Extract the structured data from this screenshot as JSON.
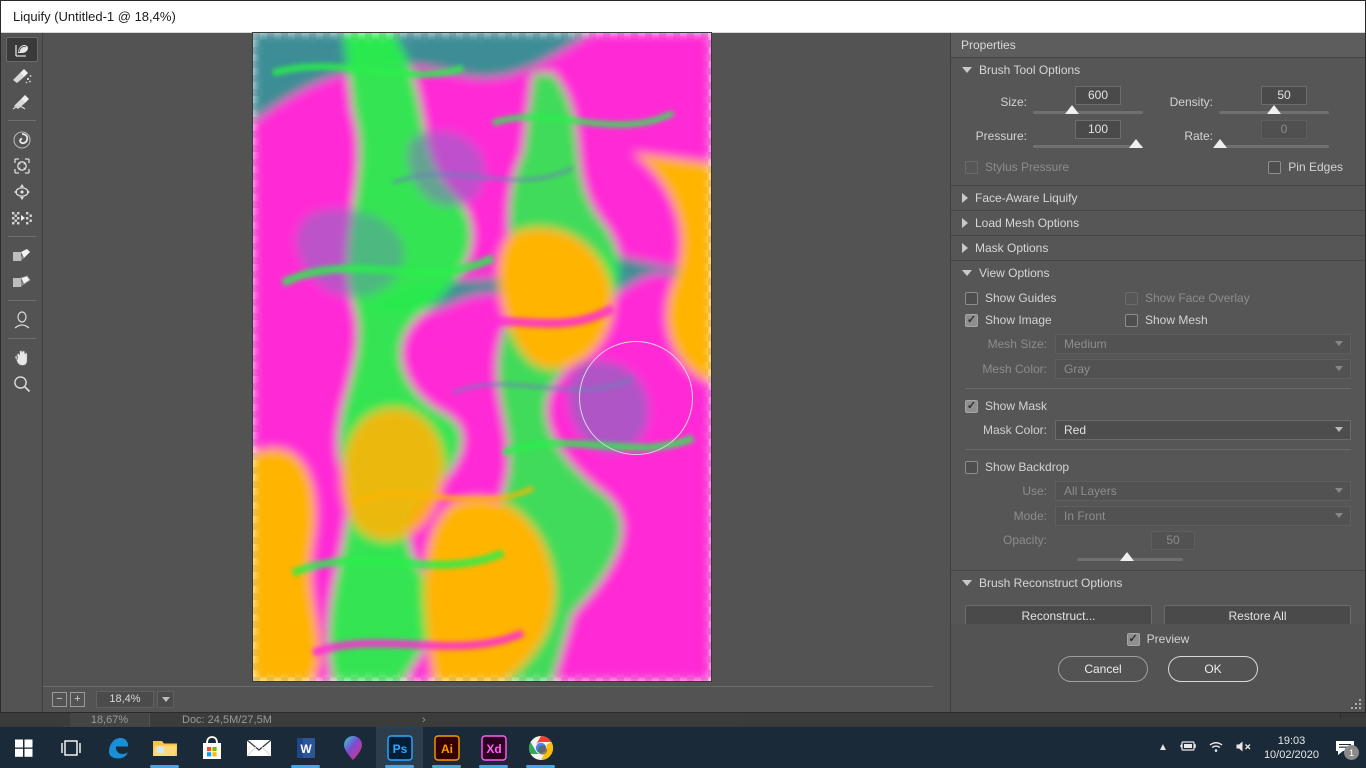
{
  "window": {
    "title": "Liquify (Untitled-1 @ 18,4%)"
  },
  "toolbar": {
    "tools": [
      {
        "name": "forward-warp-tool",
        "selected": true
      },
      {
        "name": "reconstruct-tool",
        "selected": false
      },
      {
        "name": "smooth-tool",
        "selected": false
      },
      {
        "name": "twirl-clockwise-tool",
        "selected": false
      },
      {
        "name": "pucker-tool",
        "selected": false
      },
      {
        "name": "bloat-tool",
        "selected": false
      },
      {
        "name": "push-left-tool",
        "selected": false
      },
      {
        "name": "freeze-mask-tool",
        "selected": false
      },
      {
        "name": "thaw-mask-tool",
        "selected": false
      },
      {
        "name": "face-tool",
        "selected": false
      },
      {
        "name": "hand-tool",
        "selected": false
      },
      {
        "name": "zoom-tool",
        "selected": false
      }
    ]
  },
  "canvas": {
    "zoom_level": "18,4%",
    "zoom_out_label": "−",
    "zoom_in_label": "+"
  },
  "properties": {
    "header": "Properties",
    "brush_tool_options": {
      "title": "Brush Tool Options",
      "expanded": true,
      "size": {
        "label": "Size:",
        "value": "600",
        "thumb_pct": 33
      },
      "density": {
        "label": "Density:",
        "value": "50",
        "thumb_pct": 50
      },
      "pressure": {
        "label": "Pressure:",
        "value": "100",
        "thumb_pct": 96
      },
      "rate": {
        "label": "Rate:",
        "value": "0",
        "thumb_pct": 2,
        "disabled": true
      },
      "stylus_pressure": {
        "label": "Stylus Pressure",
        "checked": false,
        "disabled": true
      },
      "pin_edges": {
        "label": "Pin Edges",
        "checked": false,
        "disabled": false
      }
    },
    "face_aware_liquify": {
      "title": "Face-Aware Liquify",
      "expanded": false
    },
    "load_mesh_options": {
      "title": "Load Mesh Options",
      "expanded": false
    },
    "mask_options": {
      "title": "Mask Options",
      "expanded": false
    },
    "view_options": {
      "title": "View Options",
      "expanded": true,
      "show_guides": {
        "label": "Show Guides",
        "checked": false,
        "disabled": false
      },
      "show_face_overlay": {
        "label": "Show Face Overlay",
        "checked": false,
        "disabled": true
      },
      "show_image": {
        "label": "Show Image",
        "checked": true,
        "disabled": false
      },
      "show_mesh": {
        "label": "Show Mesh",
        "checked": false,
        "disabled": false
      },
      "mesh_size": {
        "label": "Mesh Size:",
        "value": "Medium",
        "disabled": true
      },
      "mesh_color": {
        "label": "Mesh Color:",
        "value": "Gray",
        "disabled": true
      },
      "show_mask": {
        "label": "Show Mask",
        "checked": true,
        "disabled": false
      },
      "mask_color": {
        "label": "Mask Color:",
        "value": "Red",
        "disabled": false
      },
      "show_backdrop": {
        "label": "Show Backdrop",
        "checked": false,
        "disabled": false
      },
      "use": {
        "label": "Use:",
        "value": "All Layers",
        "disabled": true
      },
      "mode": {
        "label": "Mode:",
        "value": "In Front",
        "disabled": true
      },
      "opacity": {
        "label": "Opacity:",
        "value": "50",
        "disabled": true,
        "thumb_pct": 41
      }
    },
    "brush_reconstruct_options": {
      "title": "Brush Reconstruct Options",
      "expanded": true,
      "reconstruct_button": "Reconstruct...",
      "restore_all_button": "Restore All"
    }
  },
  "footer": {
    "preview": {
      "label": "Preview",
      "checked": true
    },
    "cancel_button": "Cancel",
    "ok_button": "OK"
  },
  "photoshop_background": {
    "status_zoom": "18,67%",
    "status_doc": "Doc: 24,5M/27,5M",
    "status_arrow": "›"
  },
  "taskbar": {
    "items": [
      {
        "name": "start-button",
        "label": "Start"
      },
      {
        "name": "task-view-button",
        "label": "Task View"
      },
      {
        "name": "taskbar-item-edge",
        "label": "Microsoft Edge"
      },
      {
        "name": "taskbar-item-file-explorer",
        "label": "File Explorer"
      },
      {
        "name": "taskbar-item-microsoft-store",
        "label": "Microsoft Store"
      },
      {
        "name": "taskbar-item-mail",
        "label": "Mail"
      },
      {
        "name": "taskbar-item-word",
        "label": "Word"
      },
      {
        "name": "taskbar-item-maps",
        "label": "Maps"
      },
      {
        "name": "taskbar-item-photoshop",
        "label": "Ps"
      },
      {
        "name": "taskbar-item-illustrator",
        "label": "Ai"
      },
      {
        "name": "taskbar-item-xd",
        "label": "Xd"
      },
      {
        "name": "taskbar-item-chrome",
        "label": "Google Chrome"
      }
    ],
    "tray": {
      "time": "19:03",
      "date": "10/02/2020",
      "notification_count": "1"
    }
  },
  "colors": {
    "dialog_bg": "#535353",
    "panel_bg": "#565656",
    "titlebar_bg": "#ffffff",
    "taskbar_bg": "#1b2a38",
    "accent_magenta": "#ff2bd6",
    "accent_green": "#2aee4c",
    "accent_orange": "#ffb400",
    "accent_teal": "#3e8d96"
  }
}
